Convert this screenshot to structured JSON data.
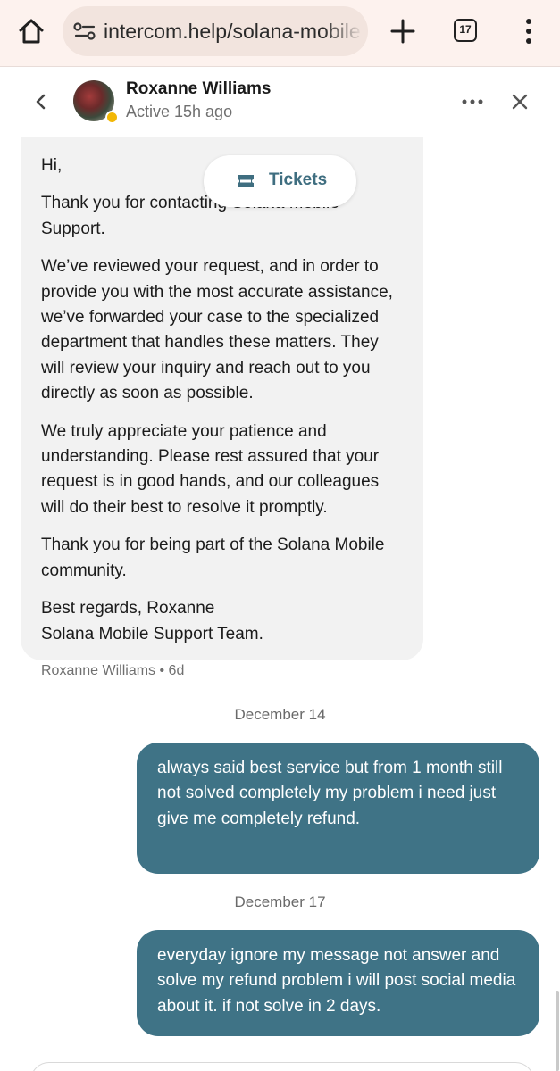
{
  "browser": {
    "url": "intercom.help/solana-mobile",
    "tab_count": "17",
    "icons": [
      "home-icon",
      "site-info-icon",
      "plus-icon",
      "tab-switcher-icon",
      "kebab-menu-icon"
    ]
  },
  "header": {
    "contact_name": "Roxanne Williams",
    "status": "Active 15h ago",
    "status_color": "#f2b705",
    "icons": [
      "back-chevron-icon",
      "more-horizontal-icon",
      "close-icon"
    ]
  },
  "floating": {
    "tickets_label": "Tickets",
    "accent_color": "#3f6e80"
  },
  "messages": {
    "agent": {
      "paragraphs": [
        "Hi,",
        "Thank you for contacting Solana Mobile Support.",
        "We’ve reviewed your request, and in order to provide you with the most accurate assistance, we’ve forwarded your case to the specialized department that handles these matters. They will review your inquiry and reach out to you directly as soon as possible.",
        "We truly appreciate your patience and understanding. Please rest assured that your request is in good hands, and our colleagues will do their best to resolve it promptly.",
        "Thank you for being part of the Solana Mobile community.",
        "Best regards, Roxanne",
        "Solana Mobile Support Team."
      ],
      "author": "Roxanne Williams",
      "age": "6d"
    },
    "date_1": "December 14",
    "user_1": "always said best service but from 1 month still not solved completely my problem i need just give me completely refund.",
    "date_2": "December 17",
    "user_2": "everyday ignore my message not answer and solve my refund problem i will post social media about it. if not solve in 2 days."
  },
  "colors": {
    "user_bubble": "#3f7386",
    "agent_bubble": "#f2f2f2",
    "browser_bar": "#fdf2ee"
  }
}
